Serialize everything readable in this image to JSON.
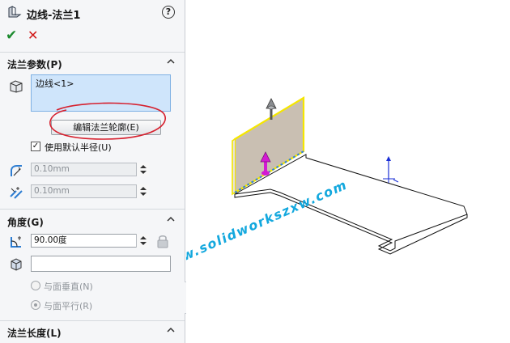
{
  "panel": {
    "title": "边线-法兰1",
    "help": "?",
    "ok": "✔",
    "cancel": "✕"
  },
  "flange_params": {
    "title": "法兰参数(P)",
    "edge_selection": "边线<1>",
    "edit_profile_button": "编辑法兰轮廓(E)",
    "use_default_radius_label": "使用默认半径(U)",
    "use_default_radius_checked": true,
    "radius_value": "0.10mm",
    "gap_value": "0.10mm"
  },
  "angle": {
    "title": "角度(G)",
    "angle_value": "90.00度",
    "face_value": "",
    "perpendicular_label": "与面垂直(N)",
    "parallel_label": "与面平行(R)"
  },
  "flange_length": {
    "title": "法兰长度(L)"
  },
  "viewport": {
    "watermark": "www.solidworkszxw.com"
  },
  "colors": {
    "accent_green": "#1c8a2e",
    "cancel_red": "#d11a1a",
    "selection_blue": "#cfe5fb",
    "highlight_yellow": "#f5e600",
    "watermark_blue": "#13a8de",
    "handle_magenta": "#d31ad3"
  }
}
